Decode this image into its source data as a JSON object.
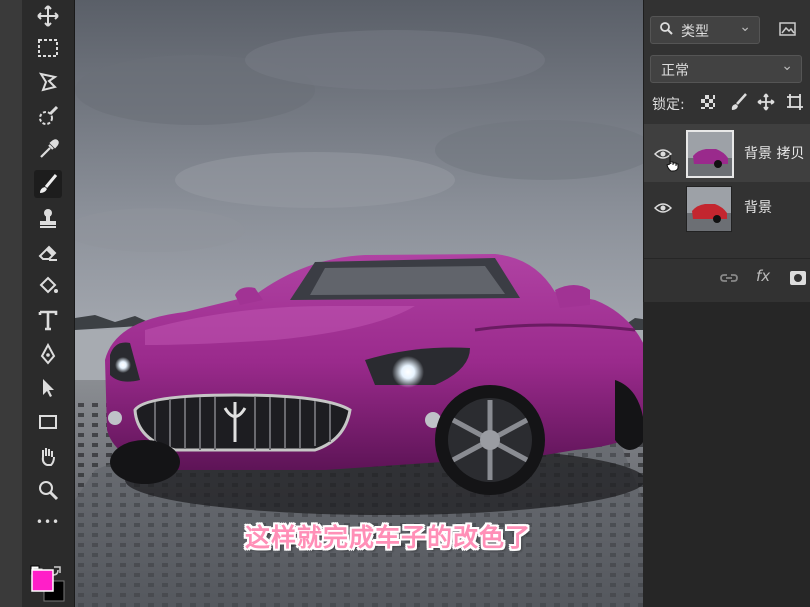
{
  "layers_panel": {
    "filter_kind": "类型",
    "blend_mode": "正常",
    "lock_label": "锁定:",
    "layers": [
      {
        "name": "背景 拷贝",
        "selected": true
      },
      {
        "name": "背景",
        "selected": false
      }
    ],
    "fx_label": "fx"
  },
  "toolbar": {
    "more_label": "•••",
    "tools": [
      "move-tool",
      "marquee-tool",
      "lasso-tool",
      "quick-select-tool",
      "eyedropper-tool",
      "brush-tool",
      "clone-stamp-tool",
      "eraser-tool",
      "paint-bucket-tool",
      "type-tool",
      "pen-tool",
      "path-select-tool",
      "rectangle-tool",
      "hand-tool",
      "zoom-tool",
      "more-tools"
    ],
    "active_tool": "brush-tool",
    "foreground_color": "#ff1fc8",
    "background_color": "#000000"
  },
  "caption": "这样就完成车子的改色了",
  "colors": {
    "car_body": "#9a2a8c",
    "panel_bg": "#323232",
    "toolbar_bg": "#2b2b2b"
  }
}
